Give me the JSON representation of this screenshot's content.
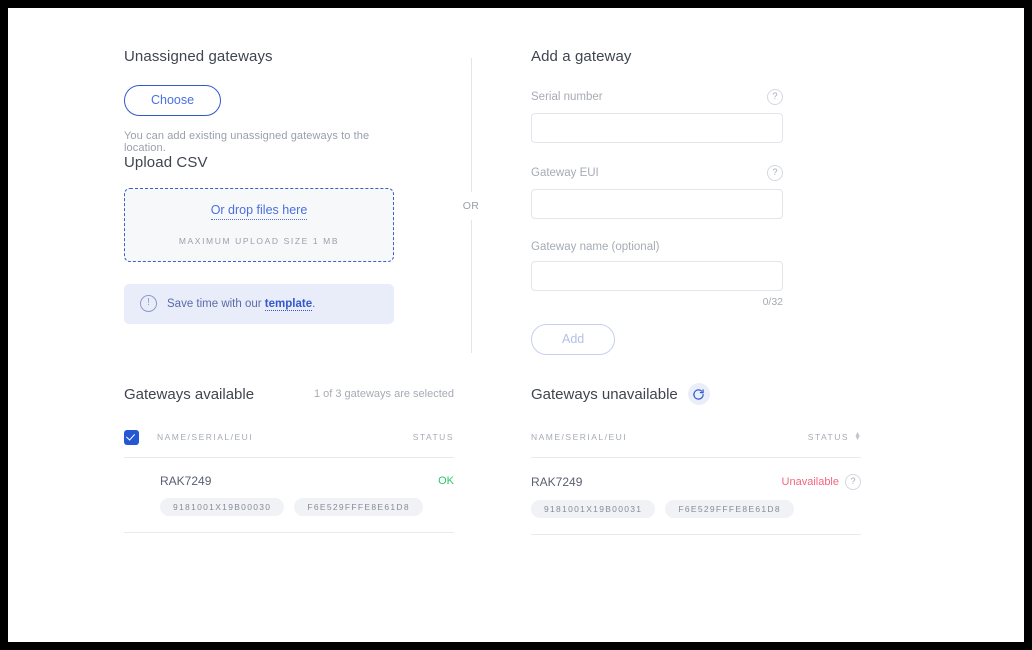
{
  "unassigned": {
    "title": "Unassigned gateways",
    "choose_label": "Choose",
    "helper": "You can add existing unassigned gateways to the location.",
    "upload_title": "Upload CSV",
    "drop_link": "Or drop files here",
    "drop_sub": "MAXIMUM UPLOAD SIZE 1 MB",
    "banner_icon": "info-circle-icon",
    "banner_prefix": "Save time with our ",
    "banner_link": "template",
    "banner_suffix": "."
  },
  "divider": {
    "or_label": "OR"
  },
  "add_gateway": {
    "title": "Add a gateway",
    "fields": [
      {
        "label": "Serial number",
        "value": "",
        "placeholder": "",
        "help": "?"
      },
      {
        "label": "Gateway EUI",
        "value": "",
        "placeholder": "",
        "help": "?"
      },
      {
        "label": "Gateway name (optional)",
        "value": "",
        "placeholder": "",
        "help": ""
      }
    ],
    "counter": "0/32",
    "add_label": "Add"
  },
  "available": {
    "title": "Gateways available",
    "selected_text": "1 of 3 gateways are selected",
    "columns": {
      "name": "NAME/SERIAL/EUI",
      "status": "STATUS"
    },
    "header_checked": true,
    "rows": [
      {
        "checked": true,
        "name": "RAK7249",
        "status": "OK",
        "status_color": "#2fc56e",
        "serial": "9181001X19B00030",
        "eui": "F6E529FFFE8E61D8"
      }
    ]
  },
  "unavailable": {
    "title": "Gateways unavailable",
    "refresh_icon": "refresh-icon",
    "columns": {
      "name": "NAME/SERIAL/EUI",
      "status": "STATUS"
    },
    "sort_icon": "sort-arrows-icon",
    "rows": [
      {
        "name": "RAK7249",
        "status": "Unavailable",
        "status_color": "#f4667f",
        "help": "?",
        "serial": "9181001X19B00031",
        "eui": "F6E529FFFE8E61D8"
      }
    ]
  },
  "colors": {
    "accent": "#2556d4",
    "link": "#4a6fe0",
    "ok": "#2fc56e",
    "error": "#f4667f",
    "banner_bg": "#e9edfa"
  }
}
